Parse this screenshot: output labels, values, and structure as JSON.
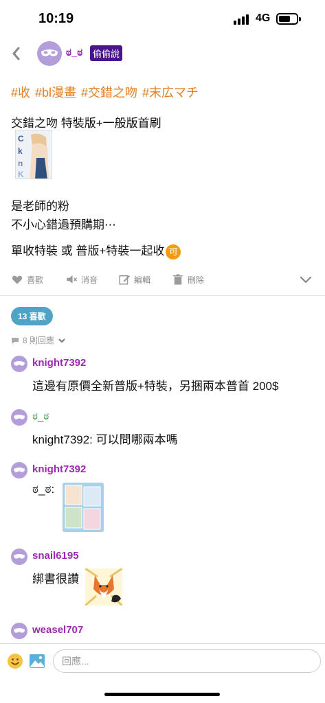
{
  "status": {
    "time": "10:19",
    "network": "4G"
  },
  "header": {
    "author": "ಠ_ಠ",
    "badge": "偷偷說"
  },
  "post": {
    "tags": "#收 #bl漫畫 #交錯之吻 #末広マチ",
    "title": "交錯之吻 特裝版+一般版首刷",
    "line1": "是老師的粉",
    "line2": "不小心錯過預購期⋯",
    "line3": "單收特裝 或 普版+特裝一起收",
    "coin": "可"
  },
  "actions": {
    "like": "喜歡",
    "mute": "消音",
    "edit": "編輯",
    "delete": "刪除"
  },
  "likes_pill": "13 喜歡",
  "reply_count": "8 則回應",
  "comments": [
    {
      "user": "knight7392",
      "text": "這邊有原價全新普版+特裝，另捆兩本普首 200$"
    },
    {
      "user": "ಠ_ಠ",
      "text": "knight7392: 可以問哪兩本嗎"
    },
    {
      "user": "knight7392",
      "text": "ಠ_ಠ:"
    },
    {
      "user": "snail6195",
      "text": "綁書很讚"
    },
    {
      "user": "weasel707",
      "text": ""
    }
  ],
  "reply_bar": {
    "placeholder": "回應..."
  },
  "colors": {
    "username": "#9c27b0",
    "tag": "#e67e22",
    "badge_bg": "#4a148c",
    "pill_bg": "#4fa3c4",
    "avatar_bg": "#b39ddb"
  }
}
